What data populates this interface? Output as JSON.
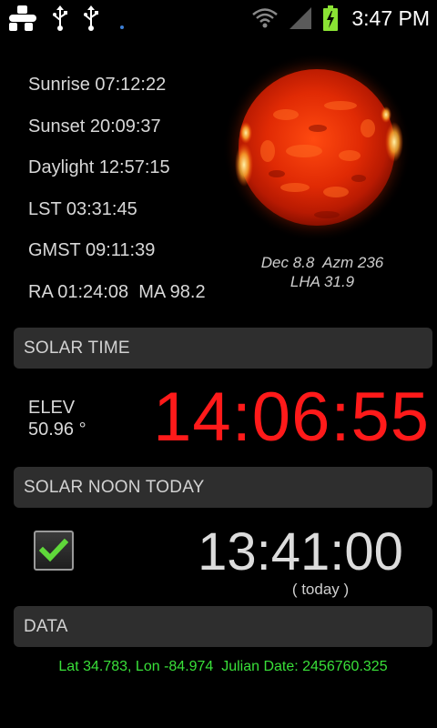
{
  "status_bar": {
    "clock": "3:47 PM",
    "icons": [
      "app-notification-icon",
      "usb-icon",
      "usb-icon",
      "wifi-icon",
      "cell-signal-icon",
      "battery-charging-icon"
    ]
  },
  "info": {
    "sunrise": "Sunrise 07:12:22",
    "sunset": "Sunset 20:09:37",
    "daylight": "Daylight 12:57:15",
    "lst": "LST 03:31:45",
    "gmst": "GMST 09:11:39",
    "ra_ma": "RA 01:24:08  MA 98.2"
  },
  "sun": {
    "caption_line1": "Dec 8.8  Azm 236",
    "caption_line2": "LHA 31.9"
  },
  "solar_time": {
    "header": "SOLAR TIME",
    "elev_label": "ELEV",
    "elev_value": "50.96 °",
    "time": "14:06:55"
  },
  "solar_noon": {
    "header": "SOLAR NOON TODAY",
    "checked": true,
    "time": "13:41:00",
    "sub": "( today )"
  },
  "data_section": {
    "header": "DATA",
    "line": "Lat 34.783, Lon -84.974  Julian Date: 2456760.325"
  },
  "colors": {
    "background": "#000000",
    "solar_time": "#ff1a1a",
    "data_text": "#39e039",
    "checkmark": "#5fd83a",
    "header_bg": "#2e2e2e"
  }
}
